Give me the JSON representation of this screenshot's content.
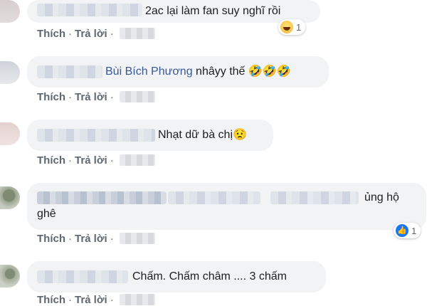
{
  "actions": {
    "like": "Thích",
    "reply": "Trả lời",
    "separator": "·"
  },
  "comments": [
    {
      "text": "2ac lại làm fan suy nghĩ rồi",
      "reaction_count": "1",
      "reaction": "haha-icon"
    },
    {
      "mention": "Bùi Bích Phương",
      "text": " nhâyy thế 🤣🤣🤣"
    },
    {
      "text": "Nhạt dữ bà chị😟"
    },
    {
      "text_line1": "ủng hộ",
      "text_line2": "ghê",
      "reaction_count": "1",
      "reaction": "like-icon",
      "accent": "#1877f2"
    },
    {
      "text": "Chấm. Chấm châm .... 3 chấm"
    }
  ]
}
